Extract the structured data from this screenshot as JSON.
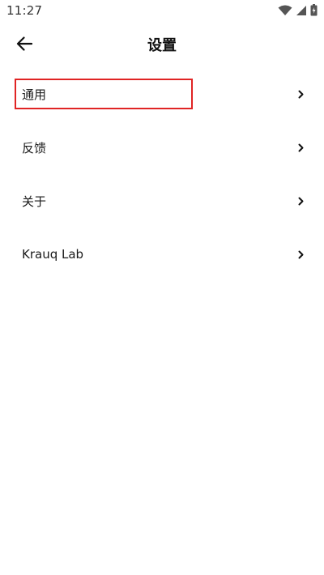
{
  "status_bar": {
    "time": "11:27",
    "icons": [
      "wifi-icon",
      "cellular-signal-icon",
      "battery-charging-icon"
    ]
  },
  "app_bar": {
    "back_icon": "arrow-left-icon",
    "title": "设置"
  },
  "settings": {
    "items": [
      {
        "label": "通用",
        "icon": "chevron-right-icon",
        "highlighted": true
      },
      {
        "label": "反馈",
        "icon": "chevron-right-icon"
      },
      {
        "label": "关于",
        "icon": "chevron-right-icon"
      },
      {
        "label": "Krauq Lab",
        "icon": "chevron-right-icon"
      }
    ]
  },
  "colors": {
    "highlight": "#e02424",
    "text": "#1a1a1a",
    "background": "#ffffff"
  }
}
